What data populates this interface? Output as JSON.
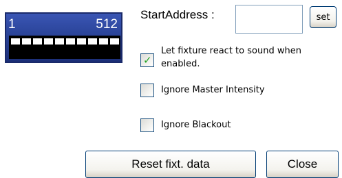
{
  "dmx_range": {
    "start": "1",
    "end": "512",
    "cell_count": 10
  },
  "start_address": {
    "label": "StartAddress :",
    "value": "",
    "placeholder": "",
    "set_label": "set"
  },
  "options": [
    {
      "label_line1": "Let fixture react to sound when",
      "label_line2": "enabled.",
      "checked": true
    },
    {
      "label": "Ignore Master Intensity",
      "checked": false
    },
    {
      "label": "Ignore Blackout",
      "checked": false
    }
  ],
  "buttons": {
    "reset_label": "Reset fixt. data",
    "close_label": "Close"
  },
  "colors": {
    "panel_blue": "#2a4398",
    "check_green": "#21a121",
    "button_border": "#003c74",
    "input_border": "#7f9db9"
  }
}
